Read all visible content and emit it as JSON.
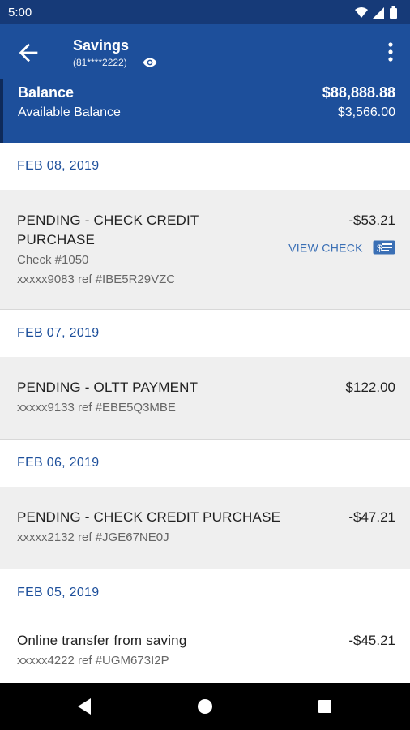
{
  "status_bar": {
    "time": "5:00"
  },
  "header": {
    "title": "Savings",
    "account_masked": "(81****2222)"
  },
  "balance": {
    "label": "Balance",
    "value": "$88,888.88",
    "available_label": "Available Balance",
    "available_value": "$3,566.00"
  },
  "groups": [
    {
      "date": "FEB 08, 2019",
      "txns": [
        {
          "title_line1": "PENDING - CHECK CREDIT",
          "title_line2": "PURCHASE",
          "check_no": "Check #1050",
          "ref": "xxxxx9083 ref #IBE5R29VZC",
          "amount": "-$53.21",
          "action": "VIEW CHECK"
        }
      ]
    },
    {
      "date": "FEB 07, 2019",
      "txns": [
        {
          "title": "PENDING - OLTT PAYMENT",
          "ref": "xxxxx9133 ref #EBE5Q3MBE",
          "amount": "$122.00"
        }
      ]
    },
    {
      "date": "FEB 06, 2019",
      "txns": [
        {
          "title": "PENDING - CHECK CREDIT PURCHASE",
          "ref": "xxxxx2132 ref #JGE67NE0J",
          "amount": "-$47.21"
        }
      ]
    },
    {
      "date": "FEB 05, 2019",
      "txns": [
        {
          "title": "Online transfer from saving",
          "ref": "xxxxx4222 ref #UGM673I2P",
          "amount": "-$45.21"
        }
      ]
    }
  ],
  "icons": {
    "back": "arrow-left-icon",
    "visibility": "eye-icon",
    "menu": "more-vert-icon",
    "check": "check-card-icon"
  },
  "colors": {
    "primary": "#1d4f9b",
    "status_bar": "#163a78",
    "date_text": "#1d4f9b",
    "link": "#3a6fb5",
    "row_bg": "#efefef"
  }
}
